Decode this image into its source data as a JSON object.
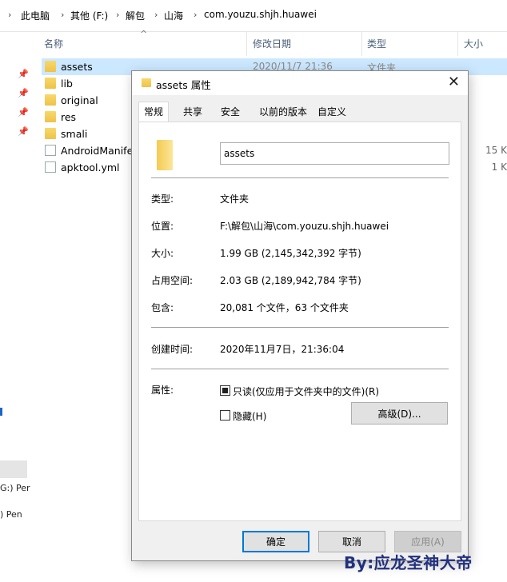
{
  "breadcrumb": [
    "此电脑",
    "其他 (F:)",
    "解包",
    "山海",
    "com.youzu.shjh.huawei"
  ],
  "columns": {
    "name": "名称",
    "date": "修改日期",
    "type": "类型",
    "size": "大小"
  },
  "files": [
    {
      "name": "assets",
      "date": "2020/11/7 21:36",
      "type": "文件夹",
      "size": "",
      "kind": "folder",
      "selected": true
    },
    {
      "name": "lib",
      "date": "",
      "type": "",
      "size": "",
      "kind": "folder"
    },
    {
      "name": "original",
      "date": "",
      "type": "",
      "size": "",
      "kind": "folder"
    },
    {
      "name": "res",
      "date": "",
      "type": "",
      "size": "",
      "kind": "folder"
    },
    {
      "name": "smali",
      "date": "",
      "type": "",
      "size": "",
      "kind": "folder"
    },
    {
      "name": "AndroidManife",
      "date": "",
      "type": "",
      "size": "15 K",
      "kind": "file"
    },
    {
      "name": "apktool.yml",
      "date": "",
      "type": "",
      "size": "1 K",
      "kind": "file"
    }
  ],
  "nav": {
    "drive_g": "G:) Per",
    "drive_pen": ") Pen"
  },
  "dialog": {
    "title": "assets 属性",
    "tabs": [
      "常规",
      "共享",
      "安全",
      "以前的版本",
      "自定义"
    ],
    "name_value": "assets",
    "props": {
      "type_label": "类型:",
      "type_value": "文件夹",
      "location_label": "位置:",
      "location_value": "F:\\解包\\山海\\com.youzu.shjh.huawei",
      "size_label": "大小:",
      "size_value": "1.99 GB (2,145,342,392 字节)",
      "disk_label": "占用空间:",
      "disk_value": "2.03 GB (2,189,942,784 字节)",
      "contains_label": "包含:",
      "contains_value": "20,081 个文件，63 个文件夹",
      "created_label": "创建时间:",
      "created_value": "2020年11月7日，21:36:04",
      "attrs_label": "属性:"
    },
    "readonly_label": "只读(仅应用于文件夹中的文件)(R)",
    "hidden_label": "隐藏(H)",
    "advanced_button": "高级(D)...",
    "ok_button": "确定",
    "cancel_button": "取消",
    "apply_button": "应用(A)"
  },
  "watermark": "By:应龙圣神大帝"
}
